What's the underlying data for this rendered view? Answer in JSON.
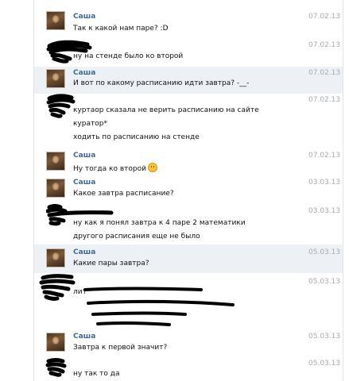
{
  "messages": [
    {
      "sender": "Саша",
      "date": "07.02.13",
      "lines": [
        "Так к какой нам паре? :D"
      ]
    },
    {
      "sender": "",
      "date": "07.02.13",
      "lines": [
        "ну на стенде было ко второй"
      ]
    },
    {
      "sender": "Саша",
      "date": "07.02.13",
      "lines": [
        "И вот по какому расписанию идти завтра? -__-"
      ]
    },
    {
      "sender": "",
      "date": "07.02.13",
      "lines": [
        "куртаор сказала не верить расписанию на сайте",
        "куратор*",
        "ходить по расписанию на стенде"
      ]
    },
    {
      "sender": "Саша",
      "date": "07.02.13",
      "lines": [
        "Ну тогда ко второй"
      ],
      "emoji": "smile-emoji"
    },
    {
      "sender": "Саша",
      "date": "03.03.13",
      "lines": [
        "Какое завтра расписание?"
      ]
    },
    {
      "sender": "",
      "date": "03.03.13",
      "lines": [
        "ну как я понял завтра к 4 паре 2 математики",
        "другого расписания еще не было"
      ]
    },
    {
      "sender": "Саша",
      "date": "05.03.13",
      "lines": [
        "Какие пары завтра?"
      ]
    },
    {
      "sender": "",
      "date": "05.03.13",
      "lines": [
        "лит"
      ]
    },
    {
      "sender": "Саша",
      "date": "05.03.13",
      "lines": [
        "Завтра к первой значит?"
      ]
    },
    {
      "sender": "",
      "date": "05.03.13",
      "lines": [
        "ну так то да"
      ]
    }
  ],
  "colors": {
    "sender": "#3e6a97",
    "date": "#a5abb1",
    "highlight": "#edf1f5",
    "redaction": "#000000"
  }
}
